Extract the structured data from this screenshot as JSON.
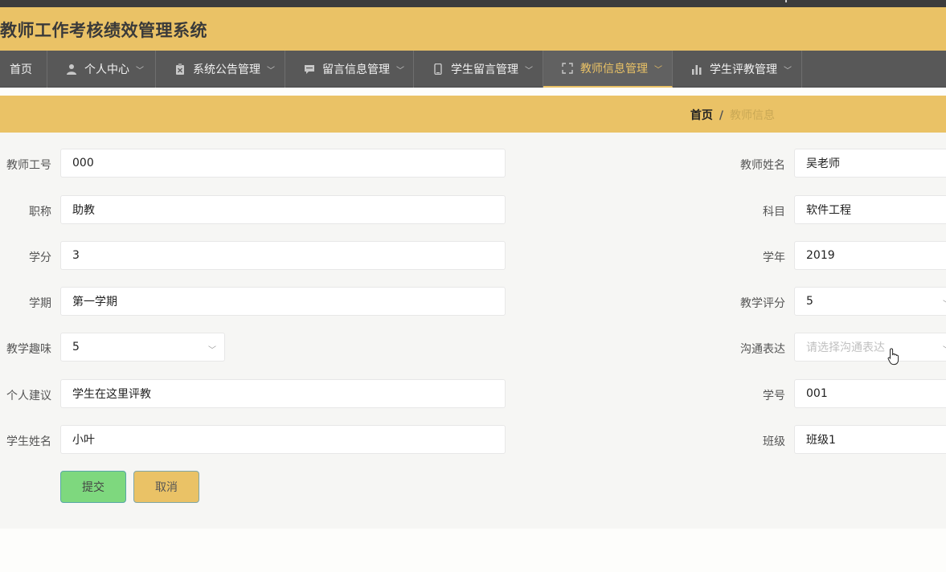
{
  "app": {
    "title": "教师工作考核绩效管理系统"
  },
  "nav": {
    "items": [
      {
        "label": "首页",
        "icon": "home-icon"
      },
      {
        "label": "个人中心",
        "icon": "user-icon"
      },
      {
        "label": "系统公告管理",
        "icon": "clipboard-icon"
      },
      {
        "label": "留言信息管理",
        "icon": "message-icon"
      },
      {
        "label": "学生留言管理",
        "icon": "phone-icon"
      },
      {
        "label": "教师信息管理",
        "icon": "fullscreen-icon",
        "active": true
      },
      {
        "label": "学生评教管理",
        "icon": "bar-chart-icon"
      }
    ]
  },
  "breadcrumb": {
    "home": "首页",
    "separator": "/",
    "current": "教师信息"
  },
  "form": {
    "teacher_id": {
      "label": "教师工号",
      "value": "000"
    },
    "teacher_name": {
      "label": "教师姓名",
      "value": "吴老师"
    },
    "title": {
      "label": "职称",
      "value": "助教"
    },
    "subject": {
      "label": "科目",
      "value": "软件工程"
    },
    "credit": {
      "label": "学分",
      "value": "3"
    },
    "school_year": {
      "label": "学年",
      "value": "2019"
    },
    "semester": {
      "label": "学期",
      "value": "第一学期"
    },
    "teaching_score": {
      "label": "教学评分",
      "value": "5"
    },
    "teaching_interest": {
      "label": "教学趣味",
      "value": "5"
    },
    "communication": {
      "label": "沟通表达",
      "value": "",
      "placeholder": "请选择沟通表达"
    },
    "suggestion": {
      "label": "个人建议",
      "value": "学生在这里评教"
    },
    "student_id": {
      "label": "学号",
      "value": "001"
    },
    "student_name": {
      "label": "学生姓名",
      "value": "小叶"
    },
    "class": {
      "label": "班级",
      "value": "班级1"
    }
  },
  "buttons": {
    "submit": "提交",
    "cancel": "取消"
  },
  "colors": {
    "accent": "#eac266",
    "nav_bg": "#585858",
    "submit": "#7ed87e"
  }
}
